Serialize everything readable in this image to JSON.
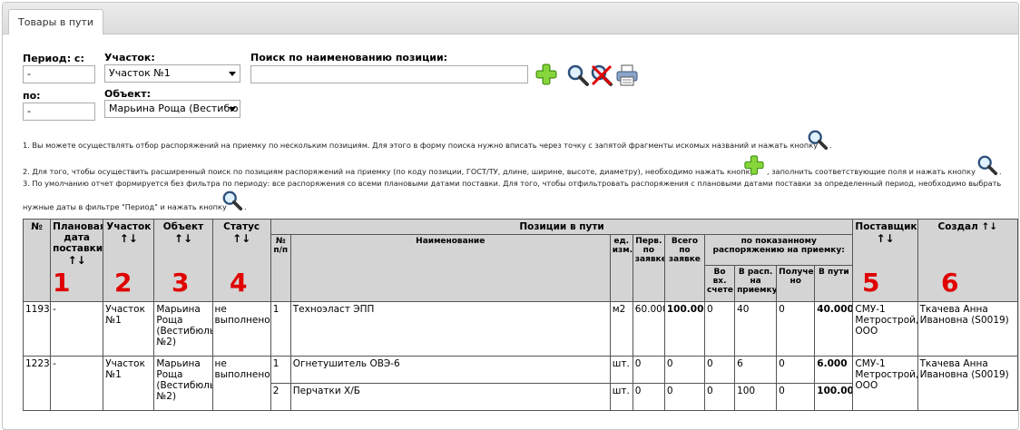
{
  "tab": {
    "label": "Товары в пути"
  },
  "filters": {
    "period_from_label": "Период: с:",
    "period_from_value": "-",
    "period_to_label": "по:",
    "period_to_value": "-",
    "site_label": "Участок:",
    "site_value": "Участок №1",
    "object_label": "Объект:",
    "object_value": "Марьина Роща (Вестибю",
    "search_label": "Поиск по наименованию позиции:",
    "search_value": ""
  },
  "icons": [
    "plus-icon",
    "search-icon",
    "clear-icon",
    "print-icon"
  ],
  "notes": {
    "n1": "1. Вы можете осуществлять отбор распоряжений на приемку по нескольким позициям. Для этого в форму поиска нужно вписать через точку с запятой фрагменты искомых названий и нажать кнопку",
    "n1_end": ".",
    "n2a": "2. Для того, чтобы осуществить расширенный поиск по позициям распоряжений на приемку (по коду позиции, ГОСТ/ТУ, длине, ширине, высоте, диаметру), необходимо нажать кнопку",
    "n2b": ", заполнить соответствующие поля и нажать кнопку",
    "n2_end": ".",
    "n3a": "3. По умолчанию отчет формируется без фильтра по периоду: все распоряжения со всеми плановыми датами поставки. Для того, чтобы отфильтровать распоряжения с плановыми датами поставки за определенный период, необходимо выбрать",
    "n3b": "нужные даты в фильтре \"Период\" и нажать кнопку",
    "n3_end": "."
  },
  "table": {
    "headers": {
      "no": "№",
      "plan_date": "Плановая дата поставки",
      "site": "Участок",
      "object": "Объект",
      "status": "Статус",
      "positions": "Позиции в пути",
      "pos_no": "№ п/п",
      "name": "Наименование",
      "unit": "ед. изм.",
      "first": "Перв. по заявке",
      "total": "Всего по заявке",
      "by_order": "по показанному распоряжению на приемку:",
      "in_invoice": "Во вх. счете",
      "in_order": "В расп. на приемку",
      "received": "Получе-но",
      "in_transit": "В пути",
      "supplier": "Поставщик",
      "created": "Создал"
    },
    "sort_glyph": "↑↓",
    "markers": [
      "1",
      "2",
      "3",
      "4",
      "5",
      "6"
    ],
    "rows": [
      {
        "no": "1193",
        "date": "-",
        "site": "Участок №1",
        "object": "Марьина Роща (Вестибюль №2)",
        "status": "не выполнено",
        "supplier": "СМУ-1 Метрострой, ООО",
        "created": "Ткачева Анна Ивановна (S0019)",
        "items": [
          {
            "pos": "1",
            "name": "Техноэласт ЭПП",
            "unit": "м2",
            "first": "60.000",
            "total": "100.000",
            "invoice": "0",
            "order": "40",
            "received": "0",
            "transit": "40.000"
          }
        ]
      },
      {
        "no": "1223",
        "date": "-",
        "site": "Участок №1",
        "object": "Марьина Роща (Вестибюль №2)",
        "status": "не выполнено",
        "supplier": "СМУ-1 Метрострой, ООО",
        "created": "Ткачева Анна Ивановна (S0019)",
        "items": [
          {
            "pos": "1",
            "name": "Огнетушитель ОВЭ-6",
            "unit": "шт.",
            "first": "0",
            "total": "0",
            "invoice": "0",
            "order": "6",
            "received": "0",
            "transit": "6.000"
          },
          {
            "pos": "2",
            "name": "Перчатки Х/Б",
            "unit": "шт.",
            "first": "0",
            "total": "0",
            "invoice": "0",
            "order": "100",
            "received": "0",
            "transit": "100.000"
          }
        ]
      }
    ]
  },
  "colors": {
    "marker": "#e00000",
    "header_bg": "#d4d4d4",
    "plus": "#6fbf2a"
  }
}
